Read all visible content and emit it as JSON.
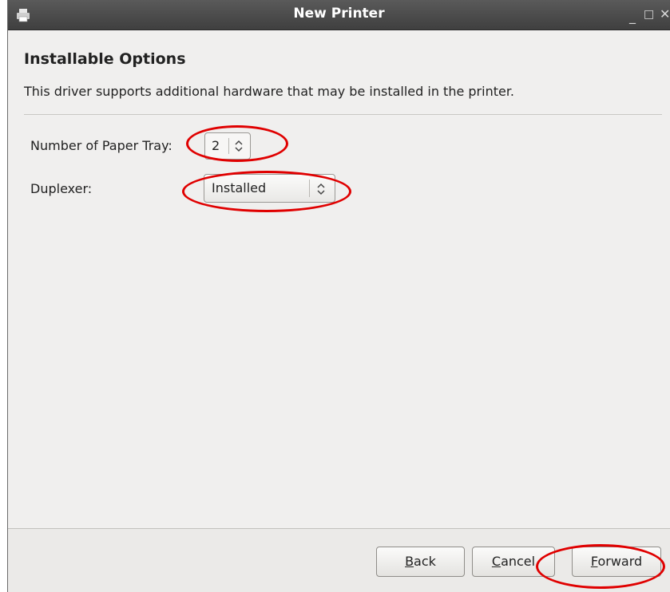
{
  "window": {
    "title": "New Printer"
  },
  "icons": {
    "app": "printer-icon",
    "minimize": "minimize-icon",
    "maximize": "maximize-icon",
    "close": "close-icon"
  },
  "content": {
    "heading": "Installable Options",
    "description": "This driver supports additional hardware that may be installed in the printer."
  },
  "options": {
    "paper_tray": {
      "label": "Number of Paper Tray:",
      "value": "2"
    },
    "duplexer": {
      "label": "Duplexer:",
      "value": "Installed"
    }
  },
  "buttons": {
    "back": {
      "mnemonic": "B",
      "rest": "ack"
    },
    "cancel": {
      "mnemonic": "C",
      "rest": "ancel"
    },
    "forward": {
      "mnemonic": "F",
      "rest": "orward"
    }
  },
  "colors": {
    "titlebar": "#4a4a4a",
    "annotation": "#e00000",
    "background": "#f0efee"
  }
}
